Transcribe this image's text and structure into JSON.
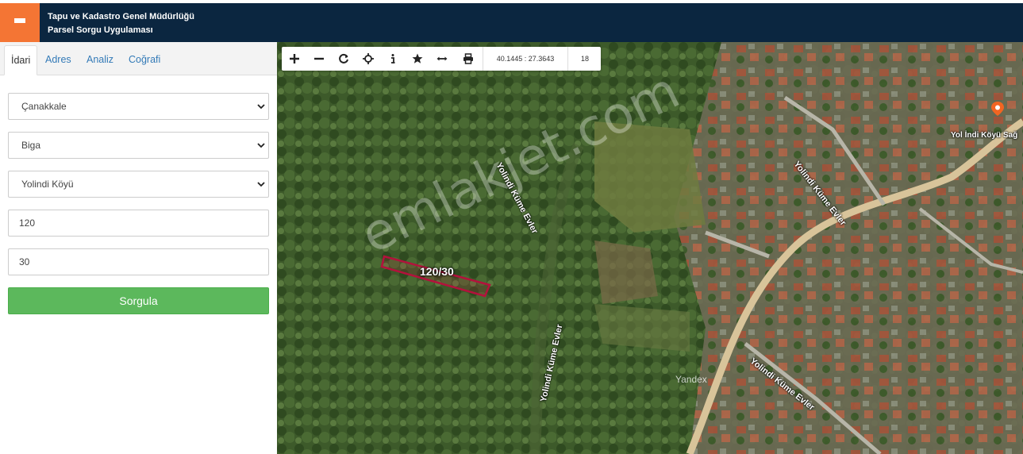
{
  "header": {
    "title_line1": "Tapu ve Kadastro Genel Müdürlüğü",
    "title_line2": "Parsel Sorgu Uygulaması",
    "menu_icon": "hamburger-menu-icon",
    "colors": {
      "bar": "#0b2640",
      "menu": "#f47534"
    }
  },
  "tabs": [
    {
      "label": "İdari",
      "active": true
    },
    {
      "label": "Adres",
      "active": false
    },
    {
      "label": "Analiz",
      "active": false
    },
    {
      "label": "Coğrafi",
      "active": false
    }
  ],
  "form": {
    "province": "Çanakkale",
    "district": "Biga",
    "neighborhood": "Yolindi Köyü",
    "block_no": "120",
    "parcel_no": "30",
    "submit_label": "Sorgula",
    "submit_color": "#5cb85c"
  },
  "toolbar": {
    "buttons": [
      "zoom-in-icon",
      "zoom-out-icon",
      "refresh-icon",
      "locate-icon",
      "info-icon",
      "favorite-star-icon",
      "measure-icon",
      "print-icon"
    ],
    "coordinates": "40.1445 : 27.3643",
    "zoom_level": "18"
  },
  "map": {
    "parcel_label": "120/30",
    "watermark": "emlakjet.com",
    "attribution": "Yandex",
    "road_labels": [
      "Yolindi Küme Evler",
      "Yolindi Küme Evler",
      "Yolindi Küme Evler",
      "Yolindi Küme Evler",
      "Yol İndi Köyü Sağ"
    ]
  }
}
